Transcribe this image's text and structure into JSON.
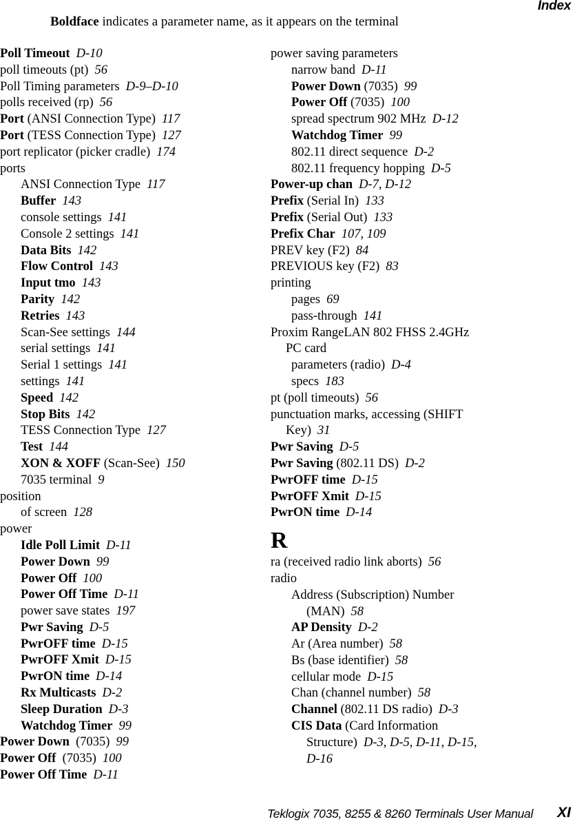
{
  "header": {
    "section_title": "Index",
    "legend_bold": "Boldface",
    "legend_rest": " indicates a parameter name, as it appears on the terminal"
  },
  "left_column": [
    {
      "level": 0,
      "bold": "Poll Timeout",
      "text": "",
      "pages": "D-10"
    },
    {
      "level": 0,
      "bold": "",
      "text": "poll timeouts (pt)",
      "pages": "56"
    },
    {
      "level": 0,
      "bold": "",
      "text": "Poll Timing parameters",
      "pages": "D-9–D-10"
    },
    {
      "level": 0,
      "bold": "",
      "text": "polls received (rp)",
      "pages": "56"
    },
    {
      "level": 0,
      "bold": "Port",
      "text": " (ANSI Connection Type)",
      "pages": "117"
    },
    {
      "level": 0,
      "bold": "Port",
      "text": " (TESS Connection Type)",
      "pages": "127"
    },
    {
      "level": 0,
      "bold": "",
      "text": "port replicator (picker cradle)",
      "pages": "174"
    },
    {
      "level": 0,
      "bold": "",
      "text": "ports",
      "pages": ""
    },
    {
      "level": 1,
      "bold": "",
      "text": "ANSI Connection Type",
      "pages": "117"
    },
    {
      "level": 1,
      "bold": "Buffer",
      "text": "",
      "pages": "143"
    },
    {
      "level": 1,
      "bold": "",
      "text": "console settings",
      "pages": "141"
    },
    {
      "level": 1,
      "bold": "",
      "text": "Console 2 settings",
      "pages": "141"
    },
    {
      "level": 1,
      "bold": "Data Bits",
      "text": "",
      "pages": "142"
    },
    {
      "level": 1,
      "bold": "Flow Control",
      "text": "",
      "pages": "143"
    },
    {
      "level": 1,
      "bold": "Input tmo",
      "text": "",
      "pages": "143"
    },
    {
      "level": 1,
      "bold": "Parity",
      "text": "",
      "pages": "142"
    },
    {
      "level": 1,
      "bold": "Retries",
      "text": "",
      "pages": "143"
    },
    {
      "level": 1,
      "bold": "",
      "text": "Scan-See settings",
      "pages": "144"
    },
    {
      "level": 1,
      "bold": "",
      "text": "serial settings",
      "pages": "141"
    },
    {
      "level": 1,
      "bold": "",
      "text": "Serial 1 settings",
      "pages": "141"
    },
    {
      "level": 1,
      "bold": "",
      "text": "settings",
      "pages": "141"
    },
    {
      "level": 1,
      "bold": "Speed",
      "text": "",
      "pages": "142"
    },
    {
      "level": 1,
      "bold": "Stop Bits",
      "text": "",
      "pages": "142"
    },
    {
      "level": 1,
      "bold": "",
      "text": "TESS Connection Type",
      "pages": "127"
    },
    {
      "level": 1,
      "bold": "Test",
      "text": "",
      "pages": "144"
    },
    {
      "level": 1,
      "bold": "XON & XOFF",
      "text": " (Scan-See)",
      "pages": "150"
    },
    {
      "level": 1,
      "bold": "",
      "text": "7035 terminal",
      "pages": "9"
    },
    {
      "level": 0,
      "bold": "",
      "text": "position",
      "pages": ""
    },
    {
      "level": 1,
      "bold": "",
      "text": "of screen",
      "pages": "128"
    },
    {
      "level": 0,
      "bold": "",
      "text": "power",
      "pages": ""
    },
    {
      "level": 1,
      "bold": "Idle Poll Limit",
      "text": "",
      "pages": "D-11"
    },
    {
      "level": 1,
      "bold": "Power Down",
      "text": "",
      "pages": "99"
    },
    {
      "level": 1,
      "bold": "Power Off",
      "text": "",
      "pages": "100"
    },
    {
      "level": 1,
      "bold": "Power Off Time",
      "text": "",
      "pages": "D-11"
    },
    {
      "level": 1,
      "bold": "",
      "text": "power save states",
      "pages": "197"
    },
    {
      "level": 1,
      "bold": "Pwr Saving",
      "text": "",
      "pages": "D-5"
    },
    {
      "level": 1,
      "bold": "PwrOFF time",
      "text": "",
      "pages": "D-15"
    },
    {
      "level": 1,
      "bold": "PwrOFF Xmit",
      "text": "",
      "pages": "D-15"
    },
    {
      "level": 1,
      "bold": "PwrON time",
      "text": "",
      "pages": "D-14"
    },
    {
      "level": 1,
      "bold": "Rx Multicasts",
      "text": "",
      "pages": "D-2"
    },
    {
      "level": 1,
      "bold": "Sleep Duration",
      "text": "",
      "pages": "D-3"
    },
    {
      "level": 1,
      "bold": "Watchdog Timer",
      "text": "",
      "pages": "99"
    },
    {
      "level": 0,
      "bold": "Power Down",
      "text": "  (7035)",
      "pages": "99"
    },
    {
      "level": 0,
      "bold": "Power Off",
      "text": "  (7035)",
      "pages": "100"
    },
    {
      "level": 0,
      "bold": "Power Off Time",
      "text": "",
      "pages": "D-11"
    }
  ],
  "right_column": [
    {
      "level": 0,
      "bold": "",
      "text": "power saving parameters",
      "pages": ""
    },
    {
      "level": 1,
      "bold": "",
      "text": "narrow band",
      "pages": "D-11"
    },
    {
      "level": 1,
      "bold": "Power Down",
      "text": " (7035)",
      "pages": "99"
    },
    {
      "level": 1,
      "bold": "Power Off",
      "text": " (7035)",
      "pages": "100"
    },
    {
      "level": 1,
      "bold": "",
      "text": "spread spectrum 902 MHz",
      "pages": "D-12"
    },
    {
      "level": 1,
      "bold": "Watchdog Timer",
      "text": "",
      "pages": "99"
    },
    {
      "level": 1,
      "bold": "",
      "text": "802.11 direct sequence",
      "pages": "D-2"
    },
    {
      "level": 1,
      "bold": "",
      "text": "802.11 frequency hopping",
      "pages": "D-5"
    },
    {
      "level": 0,
      "bold": "Power-up chan",
      "text": "",
      "pages": "D-7, D-12"
    },
    {
      "level": 0,
      "bold": "Prefix",
      "text": " (Serial In)",
      "pages": "133"
    },
    {
      "level": 0,
      "bold": "Prefix",
      "text": " (Serial Out)",
      "pages": "133"
    },
    {
      "level": 0,
      "bold": "Prefix Char",
      "text": "",
      "pages": "107, 109"
    },
    {
      "level": 0,
      "bold": "",
      "text": "PREV key (F2)",
      "pages": "84"
    },
    {
      "level": 0,
      "bold": "",
      "text": "PREVIOUS key (F2)",
      "pages": "83"
    },
    {
      "level": 0,
      "bold": "",
      "text": "printing",
      "pages": ""
    },
    {
      "level": 1,
      "bold": "",
      "text": "pages",
      "pages": "69"
    },
    {
      "level": 1,
      "bold": "",
      "text": "pass-through",
      "pages": "141"
    },
    {
      "level": 0,
      "bold": "",
      "text": "Proxim RangeLAN 802 FHSS 2.4GHz",
      "pages": ""
    },
    {
      "level": 2,
      "bold": "",
      "text": "PC card",
      "pages": ""
    },
    {
      "level": 1,
      "bold": "",
      "text": "parameters (radio)",
      "pages": "D-4"
    },
    {
      "level": 1,
      "bold": "",
      "text": "specs",
      "pages": "183"
    },
    {
      "level": 0,
      "bold": "",
      "text": "pt (poll timeouts)",
      "pages": "56"
    },
    {
      "level": 0,
      "bold": "",
      "text": "punctuation marks, accessing (SHIFT",
      "pages": ""
    },
    {
      "level": 2,
      "bold": "",
      "text": "Key)",
      "pages": "31"
    },
    {
      "level": 0,
      "bold": "Pwr Saving",
      "text": "",
      "pages": "D-5"
    },
    {
      "level": 0,
      "bold": "Pwr Saving",
      "text": " (802.11 DS)",
      "pages": "D-2"
    },
    {
      "level": 0,
      "bold": "PwrOFF time",
      "text": "",
      "pages": "D-15"
    },
    {
      "level": 0,
      "bold": "PwrOFF Xmit",
      "text": "",
      "pages": "D-15"
    },
    {
      "level": 0,
      "bold": "PwrON time",
      "text": "",
      "pages": "D-14"
    },
    {
      "level": "letter",
      "bold": "R",
      "text": "",
      "pages": ""
    },
    {
      "level": 0,
      "bold": "",
      "text": "ra (received radio link aborts)",
      "pages": "56"
    },
    {
      "level": 0,
      "bold": "",
      "text": "radio",
      "pages": ""
    },
    {
      "level": 1,
      "bold": "",
      "text": "Address (Subscription) Number",
      "pages": ""
    },
    {
      "level": 3,
      "bold": "",
      "text": "(MAN)",
      "pages": "58"
    },
    {
      "level": 1,
      "bold": "AP Density",
      "text": "",
      "pages": "D-2"
    },
    {
      "level": 1,
      "bold": "",
      "text": "Ar (Area number)",
      "pages": "58"
    },
    {
      "level": 1,
      "bold": "",
      "text": "Bs (base identifier)",
      "pages": "58"
    },
    {
      "level": 1,
      "bold": "",
      "text": "cellular mode",
      "pages": "D-15"
    },
    {
      "level": 1,
      "bold": "",
      "text": "Chan (channel number)",
      "pages": "58"
    },
    {
      "level": 1,
      "bold": "Channel",
      "text": " (802.11 DS radio)",
      "pages": "D-3"
    },
    {
      "level": 1,
      "bold": "CIS Data",
      "text": " (Card Information",
      "pages": ""
    },
    {
      "level": 3,
      "bold": "",
      "text": "Structure)",
      "pages": "D-3, D-5, D-11, D-15,"
    },
    {
      "level": 3,
      "bold": "",
      "text": "",
      "pages": "D-16"
    }
  ],
  "footer": {
    "manual_title": "Teklogix 7035, 8255 & 8260 Terminals User Manual",
    "page_number": "XI"
  }
}
